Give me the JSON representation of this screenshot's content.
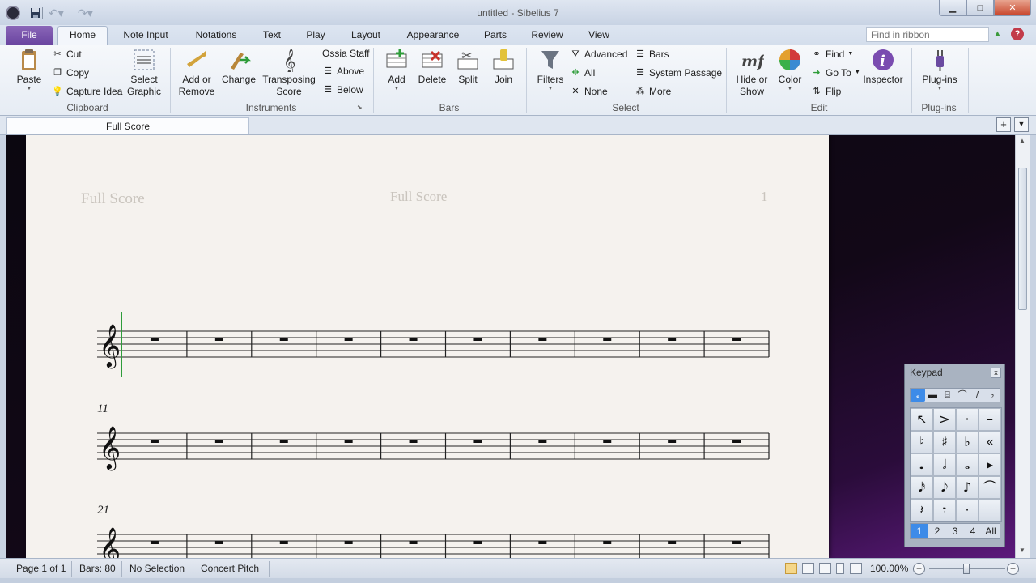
{
  "window": {
    "title": "untitled - Sibelius 7",
    "buttons": {
      "minimize": "▁",
      "maximize": "□",
      "close": "✕"
    }
  },
  "quick_access": {
    "icons": [
      "sibelius-logo-icon",
      "save-icon",
      "undo-icon",
      "redo-icon",
      "customize-icon"
    ]
  },
  "tabs": [
    "File",
    "Home",
    "Note Input",
    "Notations",
    "Text",
    "Play",
    "Layout",
    "Appearance",
    "Parts",
    "Review",
    "View"
  ],
  "active_tab": "Home",
  "ribbon_search": {
    "placeholder": "Find in ribbon"
  },
  "ribbon": {
    "clipboard": {
      "label": "Clipboard",
      "paste": "Paste",
      "cut": "Cut",
      "copy": "Copy",
      "capture_idea": "Capture Idea",
      "select_graphic_1": "Select",
      "select_graphic_2": "Graphic"
    },
    "instruments": {
      "label": "Instruments",
      "add_remove_1": "Add or",
      "add_remove_2": "Remove",
      "change": "Change",
      "transposing_1": "Transposing",
      "transposing_2": "Score",
      "ossia_staff": "Ossia Staff",
      "above": "Above",
      "below": "Below"
    },
    "bars": {
      "label": "Bars",
      "add": "Add",
      "delete": "Delete",
      "split": "Split",
      "join": "Join"
    },
    "select": {
      "label": "Select",
      "filters": "Filters",
      "advanced": "Advanced",
      "all": "All",
      "none": "None",
      "bars": "Bars",
      "system_passage": "System Passage",
      "more": "More"
    },
    "edit": {
      "label": "Edit",
      "hide_show_1": "Hide or",
      "hide_show_2": "Show",
      "color": "Color",
      "find": "Find",
      "go_to": "Go To",
      "flip": "Flip",
      "inspector": "Inspector"
    },
    "plugins": {
      "label": "Plug-ins",
      "button": "Plug-ins"
    }
  },
  "document_tab": "Full Score",
  "score": {
    "header_left": "Full Score",
    "header_center": "Full Score",
    "page_number": "1",
    "systems": [
      {
        "bar_number": ""
      },
      {
        "bar_number": "11"
      },
      {
        "bar_number": "21"
      }
    ],
    "bars_per_system": 10
  },
  "keypad": {
    "title": "Keypad",
    "close": "x",
    "tabs": [
      "𝅝",
      "▬",
      "⌸",
      "⌒",
      "/",
      "♭"
    ],
    "keys": [
      "↖",
      ">",
      "·",
      "–",
      "♮",
      "♯",
      "♭",
      "«",
      "♩",
      "𝅗𝅥",
      "𝅝",
      "▸",
      "𝅘𝅥𝅯",
      "𝅘𝅥𝅮",
      "♪",
      "⌒",
      "𝄽",
      "𝄾",
      "·",
      ""
    ],
    "layouts": [
      "1",
      "2",
      "3",
      "4",
      "All"
    ]
  },
  "statusbar": {
    "page": "Page 1 of 1",
    "bars": "Bars: 80",
    "selection": "No Selection",
    "pitch": "Concert Pitch",
    "zoom": "100.00%"
  },
  "colors": {
    "file_tab": "#7353a8",
    "workspace_accent": "#5c1a7c",
    "selection_blue": "#3d8be8",
    "caret_green": "#2e9c3a"
  }
}
